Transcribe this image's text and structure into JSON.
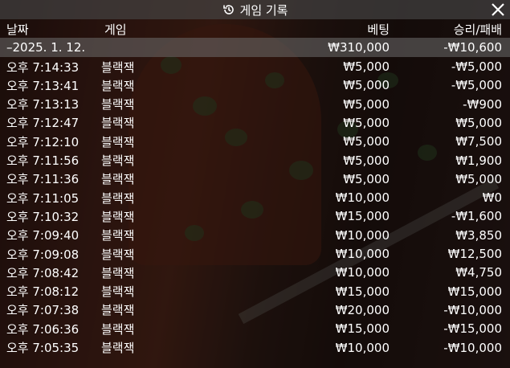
{
  "window": {
    "title": "게임 기록",
    "icons": {
      "title": "history-icon",
      "close": "close-icon"
    }
  },
  "columns": {
    "date": "날짜",
    "game": "게임",
    "bet": "베팅",
    "win_loss": "승리/패배"
  },
  "day_group": {
    "date": "–2025. 1. 12.",
    "bet_total": "₩310,000",
    "win_loss_total": "-₩10,600"
  },
  "rows": [
    {
      "time": "오후 7:14:33",
      "game": "블랙잭",
      "bet": "₩5,000",
      "win_loss": "-₩5,000"
    },
    {
      "time": "오후 7:13:41",
      "game": "블랙잭",
      "bet": "₩5,000",
      "win_loss": "-₩5,000"
    },
    {
      "time": "오후 7:13:13",
      "game": "블랙잭",
      "bet": "₩5,000",
      "win_loss": "-₩900"
    },
    {
      "time": "오후 7:12:47",
      "game": "블랙잭",
      "bet": "₩5,000",
      "win_loss": "₩5,000"
    },
    {
      "time": "오후 7:12:10",
      "game": "블랙잭",
      "bet": "₩5,000",
      "win_loss": "₩7,500"
    },
    {
      "time": "오후 7:11:56",
      "game": "블랙잭",
      "bet": "₩5,000",
      "win_loss": "₩1,900"
    },
    {
      "time": "오후 7:11:36",
      "game": "블랙잭",
      "bet": "₩5,000",
      "win_loss": "₩5,000"
    },
    {
      "time": "오후 7:11:05",
      "game": "블랙잭",
      "bet": "₩10,000",
      "win_loss": "₩0"
    },
    {
      "time": "오후 7:10:32",
      "game": "블랙잭",
      "bet": "₩15,000",
      "win_loss": "-₩1,600"
    },
    {
      "time": "오후 7:09:40",
      "game": "블랙잭",
      "bet": "₩10,000",
      "win_loss": "₩3,850"
    },
    {
      "time": "오후 7:09:08",
      "game": "블랙잭",
      "bet": "₩10,000",
      "win_loss": "₩12,500"
    },
    {
      "time": "오후 7:08:42",
      "game": "블랙잭",
      "bet": "₩10,000",
      "win_loss": "₩4,750"
    },
    {
      "time": "오후 7:08:12",
      "game": "블랙잭",
      "bet": "₩15,000",
      "win_loss": "₩15,000"
    },
    {
      "time": "오후 7:07:38",
      "game": "블랙잭",
      "bet": "₩20,000",
      "win_loss": "-₩10,000"
    },
    {
      "time": "오후 7:06:36",
      "game": "블랙잭",
      "bet": "₩15,000",
      "win_loss": "-₩15,000"
    },
    {
      "time": "오후 7:05:35",
      "game": "블랙잭",
      "bet": "₩10,000",
      "win_loss": "-₩10,000"
    }
  ]
}
